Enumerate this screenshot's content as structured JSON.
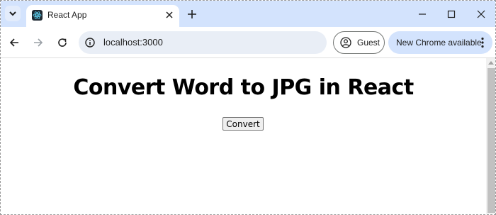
{
  "tab": {
    "title": "React App"
  },
  "omnibox": {
    "url": "localhost:3000"
  },
  "profile": {
    "label": "Guest"
  },
  "update": {
    "label": "New Chrome available"
  },
  "page": {
    "heading": "Convert Word to JPG in React",
    "button_label": "Convert"
  },
  "colors": {
    "tabstrip": "#d3e3fd",
    "omnibox": "#e9eef6",
    "update_chip": "#d3e3fd",
    "react_logo": "#61dafb"
  },
  "icons": {
    "tab_search": "chevron-down-icon",
    "favicon": "react-logo-icon",
    "tab_close": "close-icon",
    "new_tab": "plus-icon",
    "minimize": "minimize-icon",
    "maximize": "maximize-icon",
    "close_window": "close-icon",
    "back": "back-arrow-icon",
    "forward": "forward-arrow-icon",
    "reload": "reload-icon",
    "site_info": "info-icon",
    "profile": "person-icon",
    "menu": "more-vert-icon"
  }
}
